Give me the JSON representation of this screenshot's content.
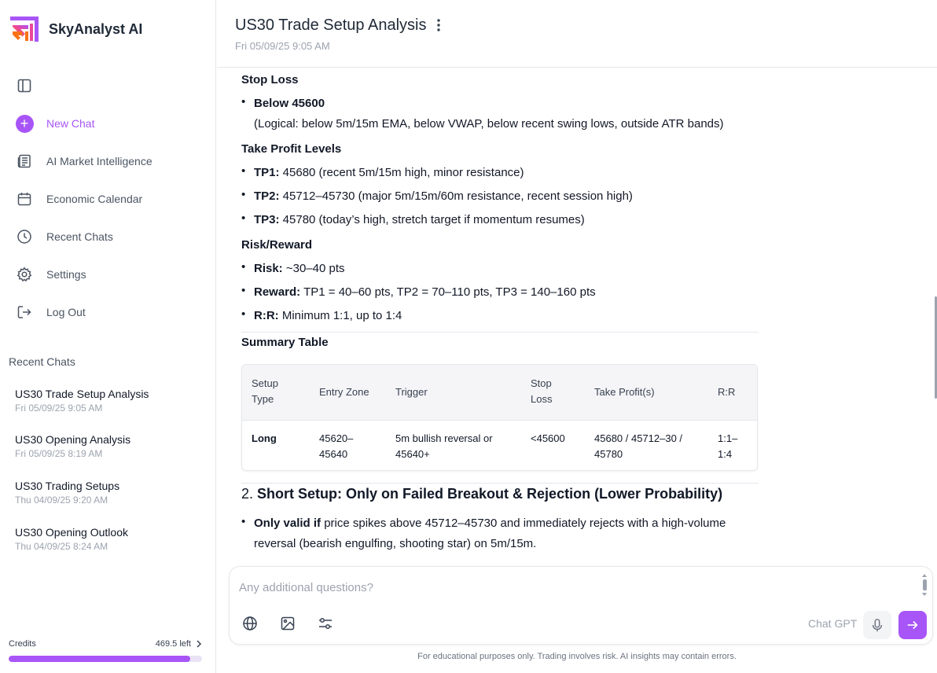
{
  "app": {
    "name": "SkyAnalyst AI",
    "accent": "#a855f7"
  },
  "sidebar": {
    "nav": [
      {
        "label": "New Chat",
        "icon": "plus-circle-icon"
      },
      {
        "label": "AI Market Intelligence",
        "icon": "newspaper-icon"
      },
      {
        "label": "Economic Calendar",
        "icon": "calendar-icon"
      },
      {
        "label": "Recent Chats",
        "icon": "clock-icon"
      },
      {
        "label": "Settings",
        "icon": "gear-icon"
      },
      {
        "label": "Log Out",
        "icon": "logout-icon"
      }
    ],
    "recent_heading": "Recent Chats",
    "recent": [
      {
        "title": "US30 Trade Setup Analysis",
        "date": "Fri 05/09/25 9:05 AM"
      },
      {
        "title": "US30 Opening Analysis",
        "date": "Fri 05/09/25 8:19 AM"
      },
      {
        "title": "US30 Trading Setups",
        "date": "Thu 04/09/25 9:20 AM"
      },
      {
        "title": "US30 Opening Outlook",
        "date": "Thu 04/09/25 8:24 AM"
      }
    ],
    "credits": {
      "label": "Credits",
      "left": "469.5 left",
      "fill_fraction": 0.94
    }
  },
  "header": {
    "title": "US30 Trade Setup Analysis",
    "date": "Fri 05/09/25 9:05 AM"
  },
  "article": {
    "stop_loss_heading": "Stop Loss",
    "stop_loss_bold": "Below 45600",
    "stop_loss_note": "(Logical: below 5m/15m EMA, below VWAP, below recent swing lows, outside ATR bands)",
    "tp_heading": "Take Profit Levels",
    "tp": [
      {
        "label": "TP1:",
        "text": " 45680 (recent 5m/15m high, minor resistance)"
      },
      {
        "label": "TP2:",
        "text": " 45712–45730 (major 5m/15m/60m resistance, recent session high)"
      },
      {
        "label": "TP3:",
        "text": " 45780 (today’s high, stretch target if momentum resumes)"
      }
    ],
    "rr_heading": "Risk/Reward",
    "rr": [
      {
        "label": "Risk:",
        "text": " ~30–40 pts"
      },
      {
        "label": "Reward:",
        "text": " TP1 = 40–60 pts, TP2 = 70–110 pts, TP3 = 140–160 pts"
      },
      {
        "label": "R:R:",
        "text": " Minimum 1:1, up to 1:4"
      }
    ],
    "summary_heading": "Summary Table",
    "table": {
      "headers": [
        "Setup Type",
        "Entry Zone",
        "Trigger",
        "Stop Loss",
        "Take Profit(s)",
        "R:R"
      ],
      "row": [
        "Long",
        "45620–45640",
        "5m bullish reversal or 45640+",
        "<45600",
        "45680 / 45712–30 / 45780",
        "1:1–1:4"
      ]
    },
    "short_number": "2. ",
    "short_heading": "Short Setup: Only on Failed Breakout & Rejection (Lower Probability)",
    "short_bullet_label": "Only valid if",
    "short_bullet_text": " price spikes above 45712–45730 and immediately rejects with a high-volume",
    "short_bullet_text2": "reversal (bearish engulfing, shooting star) on 5m/15m."
  },
  "composer": {
    "placeholder": "Any additional questions?",
    "model": "Chat GPT"
  },
  "disclaimer": "For educational purposes only. Trading involves risk. AI insights may contain errors."
}
